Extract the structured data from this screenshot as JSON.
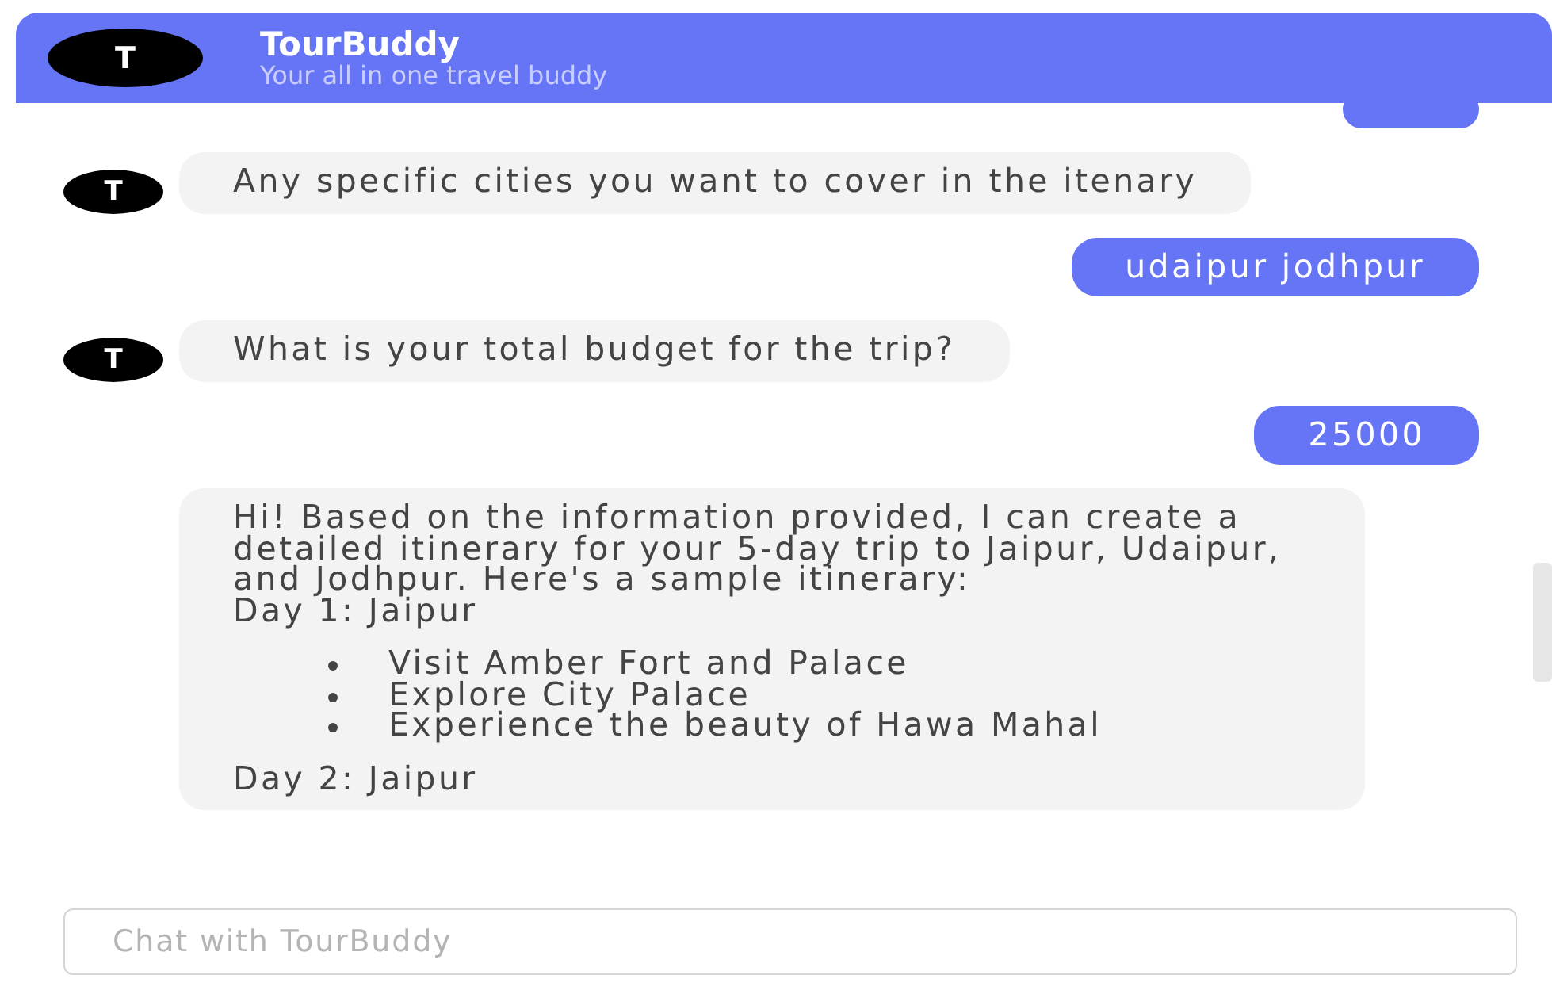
{
  "header": {
    "avatar": "T",
    "title": "TourBuddy",
    "subtitle": "Your all in one travel buddy"
  },
  "messages": [
    {
      "kind": "user"
    },
    {
      "kind": "bot",
      "avatar": "T",
      "blocks": [
        {
          "kind": "text",
          "text": "Any specific cities you want to cover in the itenary"
        }
      ]
    },
    {
      "kind": "user",
      "blocks": [
        {
          "kind": "text",
          "text": "udaipur jodhpur"
        }
      ]
    },
    {
      "kind": "bot",
      "avatar": "T",
      "blocks": [
        {
          "kind": "text",
          "text": "What is your total budget for the trip?"
        }
      ]
    },
    {
      "kind": "user",
      "blocks": [
        {
          "kind": "text",
          "text": "25000"
        }
      ]
    },
    {
      "kind": "bot",
      "blocks": [
        {
          "kind": "text",
          "text": "Hi! Based on the information provided, I can create a detailed itinerary for your 5-day trip to Jaipur, Udaipur, and Jodhpur. Here's a sample itinerary:"
        },
        {
          "kind": "text",
          "text": "Day 1: Jaipur"
        },
        {
          "kind": "list",
          "items": [
            "Visit Amber Fort and Palace",
            "Explore City Palace",
            "Experience the beauty of Hawa Mahal"
          ]
        },
        {
          "kind": "text",
          "text": "Day 2: Jaipur"
        }
      ]
    }
  ],
  "input": {
    "placeholder": "Chat with TourBuddy"
  }
}
